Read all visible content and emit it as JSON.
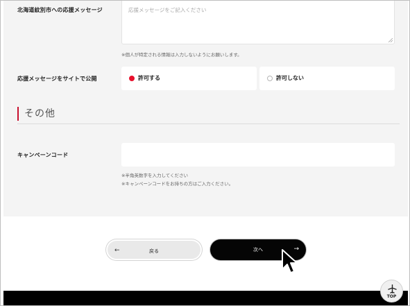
{
  "form": {
    "message_label": "北海道紋別市への応援メッセージ",
    "message_placeholder": "応援メッセージをご記入ください",
    "message_note": "※個人が特定される情報は入力しないようにお願いします。",
    "publish_label": "応援メッセージをサイトで公開",
    "publish_options": [
      {
        "label": "許可する",
        "selected": true
      },
      {
        "label": "許可しない",
        "selected": false
      }
    ]
  },
  "other_section": {
    "title": "その他",
    "campaign_label": "キャンペーンコード",
    "campaign_value": "",
    "notes": [
      "※半角英数字を入力してください",
      "※キャンペーンコードをお持ちの方はご入力ください。"
    ]
  },
  "buttons": {
    "back_label": "戻る",
    "back_arrow": "←",
    "next_label": "次へ",
    "next_arrow": "→"
  },
  "top_button": {
    "label": "TOP",
    "icon": "airplane-icon"
  },
  "colors": {
    "accent": "#c8102e",
    "primary_button": "#050505",
    "form_bg": "#f4f4f4",
    "footer": "#000000"
  }
}
